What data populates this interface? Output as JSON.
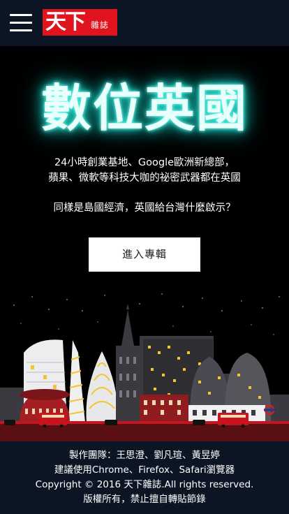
{
  "header": {
    "logo_big": "天下",
    "logo_small": "雜誌"
  },
  "hero": {
    "title": "數位英國",
    "desc_line1": "24小時創業基地、Google歐洲新總部，",
    "desc_line2": "蘋果、微軟等科技大咖的祕密武器都在英國",
    "question": "同樣是島國經濟，英國給台灣什麼啟示？",
    "enter_label": "進入專輯"
  },
  "footer": {
    "credits": "製作團隊：王思澄、劉凡瑄、黃昱婷",
    "browser": "建議使用Chrome、Firefox、Safari瀏覽器",
    "copyright": "Copyright © 2016 天下雜誌.All rights reserved.",
    "rights": "版權所有，禁止擅自轉貼節錄"
  },
  "colors": {
    "header_bg": "#0b1523",
    "logo_red": "#e0141e",
    "neon": "#2de6d6",
    "bus_red": "#c8141e"
  },
  "icons": {
    "menu": "hamburger-menu-icon",
    "underground": "underground-roundel-icon"
  }
}
